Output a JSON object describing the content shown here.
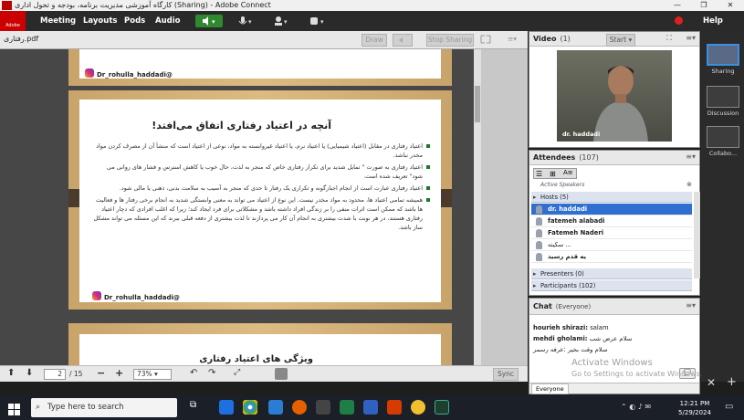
{
  "window": {
    "title": "کارگاه آموزشی مدیریت برنامه، بودجه و تحول اداری (Sharing) - Adobe Connect",
    "controls": [
      "—",
      "❐",
      "✕"
    ]
  },
  "menubar": {
    "logo_text": "Adobe",
    "items": [
      "Meeting",
      "Layouts",
      "Pods",
      "Audio"
    ],
    "help": "Help"
  },
  "share": {
    "filename": "رفتاری.pdf",
    "draw_label": "Draw",
    "stop_label": "Stop Sharing",
    "page1": {
      "instagram": "Dr_rohulla_haddadi@"
    },
    "page2": {
      "heading": "آنچه در اعتیاد رفتاری اتفاق می‌افتد!",
      "bullets": [
        "اعتیاد رفتاری در مقابل (اعتیاد شیمیایی) یا اعتیاد نرم، یا اعتیاد غیروابسته به مواد، نوعی از اعتیاد است که منشأ آن از مصرف کردن مواد مخدر نباشد.",
        "اعتیاد رفتاری به صورت \" تمایل شدید برای تکرار رفتاری خاص که منجر به لذت، حال خوب یا کاهش استرس و فشار های روانی می شود\" تعریف شده است.",
        "اعتیاد رفتاری عبارت است از انجام اجبارگونه و تکراری یک رفتار تا حدی که منجر به آسیب به سلامت بدنی، ذهنی یا مالی شود."
      ],
      "paragraph": "همیشه تمامی اعتیاد ها، محدود به مواد مخدر نیست. این نوع از اعتیاد می تواند به معنی وابستگی شدید به انجام برخی رفتار ها و فعالیت ها باشد که ممکن است اثرات منفی را بر زندگی افراد داشته باشد و مشکلاتی برای فرد ایجاد کند؛ زیرا که اغلب افرادی که دچار اعتیاد رفتاری هستند، در هر نوبت با شدت بیشتری به انجام آن کار می پردازند تا لذت بیشتری از دفعه قبلی ببرند که این مسئله می تواند مشکل ساز باشد.",
      "instagram": "Dr_rohulla_haddadi@"
    },
    "page3": {
      "heading": "ویژگی های اعتیاد رفتاری"
    },
    "footer": {
      "page_current": "2",
      "page_total": "/ 15",
      "zoom": "73%",
      "sync": "Sync"
    }
  },
  "video": {
    "title": "Video",
    "count": "(1)",
    "start_label": "Start",
    "caption": "dr. haddadi"
  },
  "attendees": {
    "title": "Attendees",
    "count": "(107)",
    "active_speakers": "Active Speakers",
    "hosts_label": "Hosts (5)",
    "hosts": [
      "dr. haddadi",
      "fatemeh alabadi",
      "Fatemeh Naderi",
      "سکینه ...",
      "یه قدم رسید"
    ],
    "presenters_label": "Presenters (0)",
    "participants_label": "Participants (102)"
  },
  "chat": {
    "title": "Chat",
    "scope": "(Everyone)",
    "messages": [
      {
        "name": "hourieh shirazi:",
        "text": "salam"
      },
      {
        "name": "mehdi gholami:",
        "text": "سلام عرض شب"
      },
      {
        "name": "",
        "text": "سلام وقت بخیر :عرفه رسمر"
      }
    ],
    "tab": "Everyone"
  },
  "tray": {
    "items": [
      "Sharing",
      "Discussion",
      "Collabo..."
    ]
  },
  "taskbar": {
    "search_placeholder": "Type here to search",
    "time": "12:21 PM",
    "date": "5/29/2024"
  },
  "watermark": {
    "line1": "Activate Windows",
    "line2": "Go to Settings to activate Windows."
  },
  "colors": {
    "accent": "#3a8fe0",
    "brand_red": "#cc0000",
    "bullet_green": "#1a7a2a",
    "page_wood": "#d4b078"
  }
}
